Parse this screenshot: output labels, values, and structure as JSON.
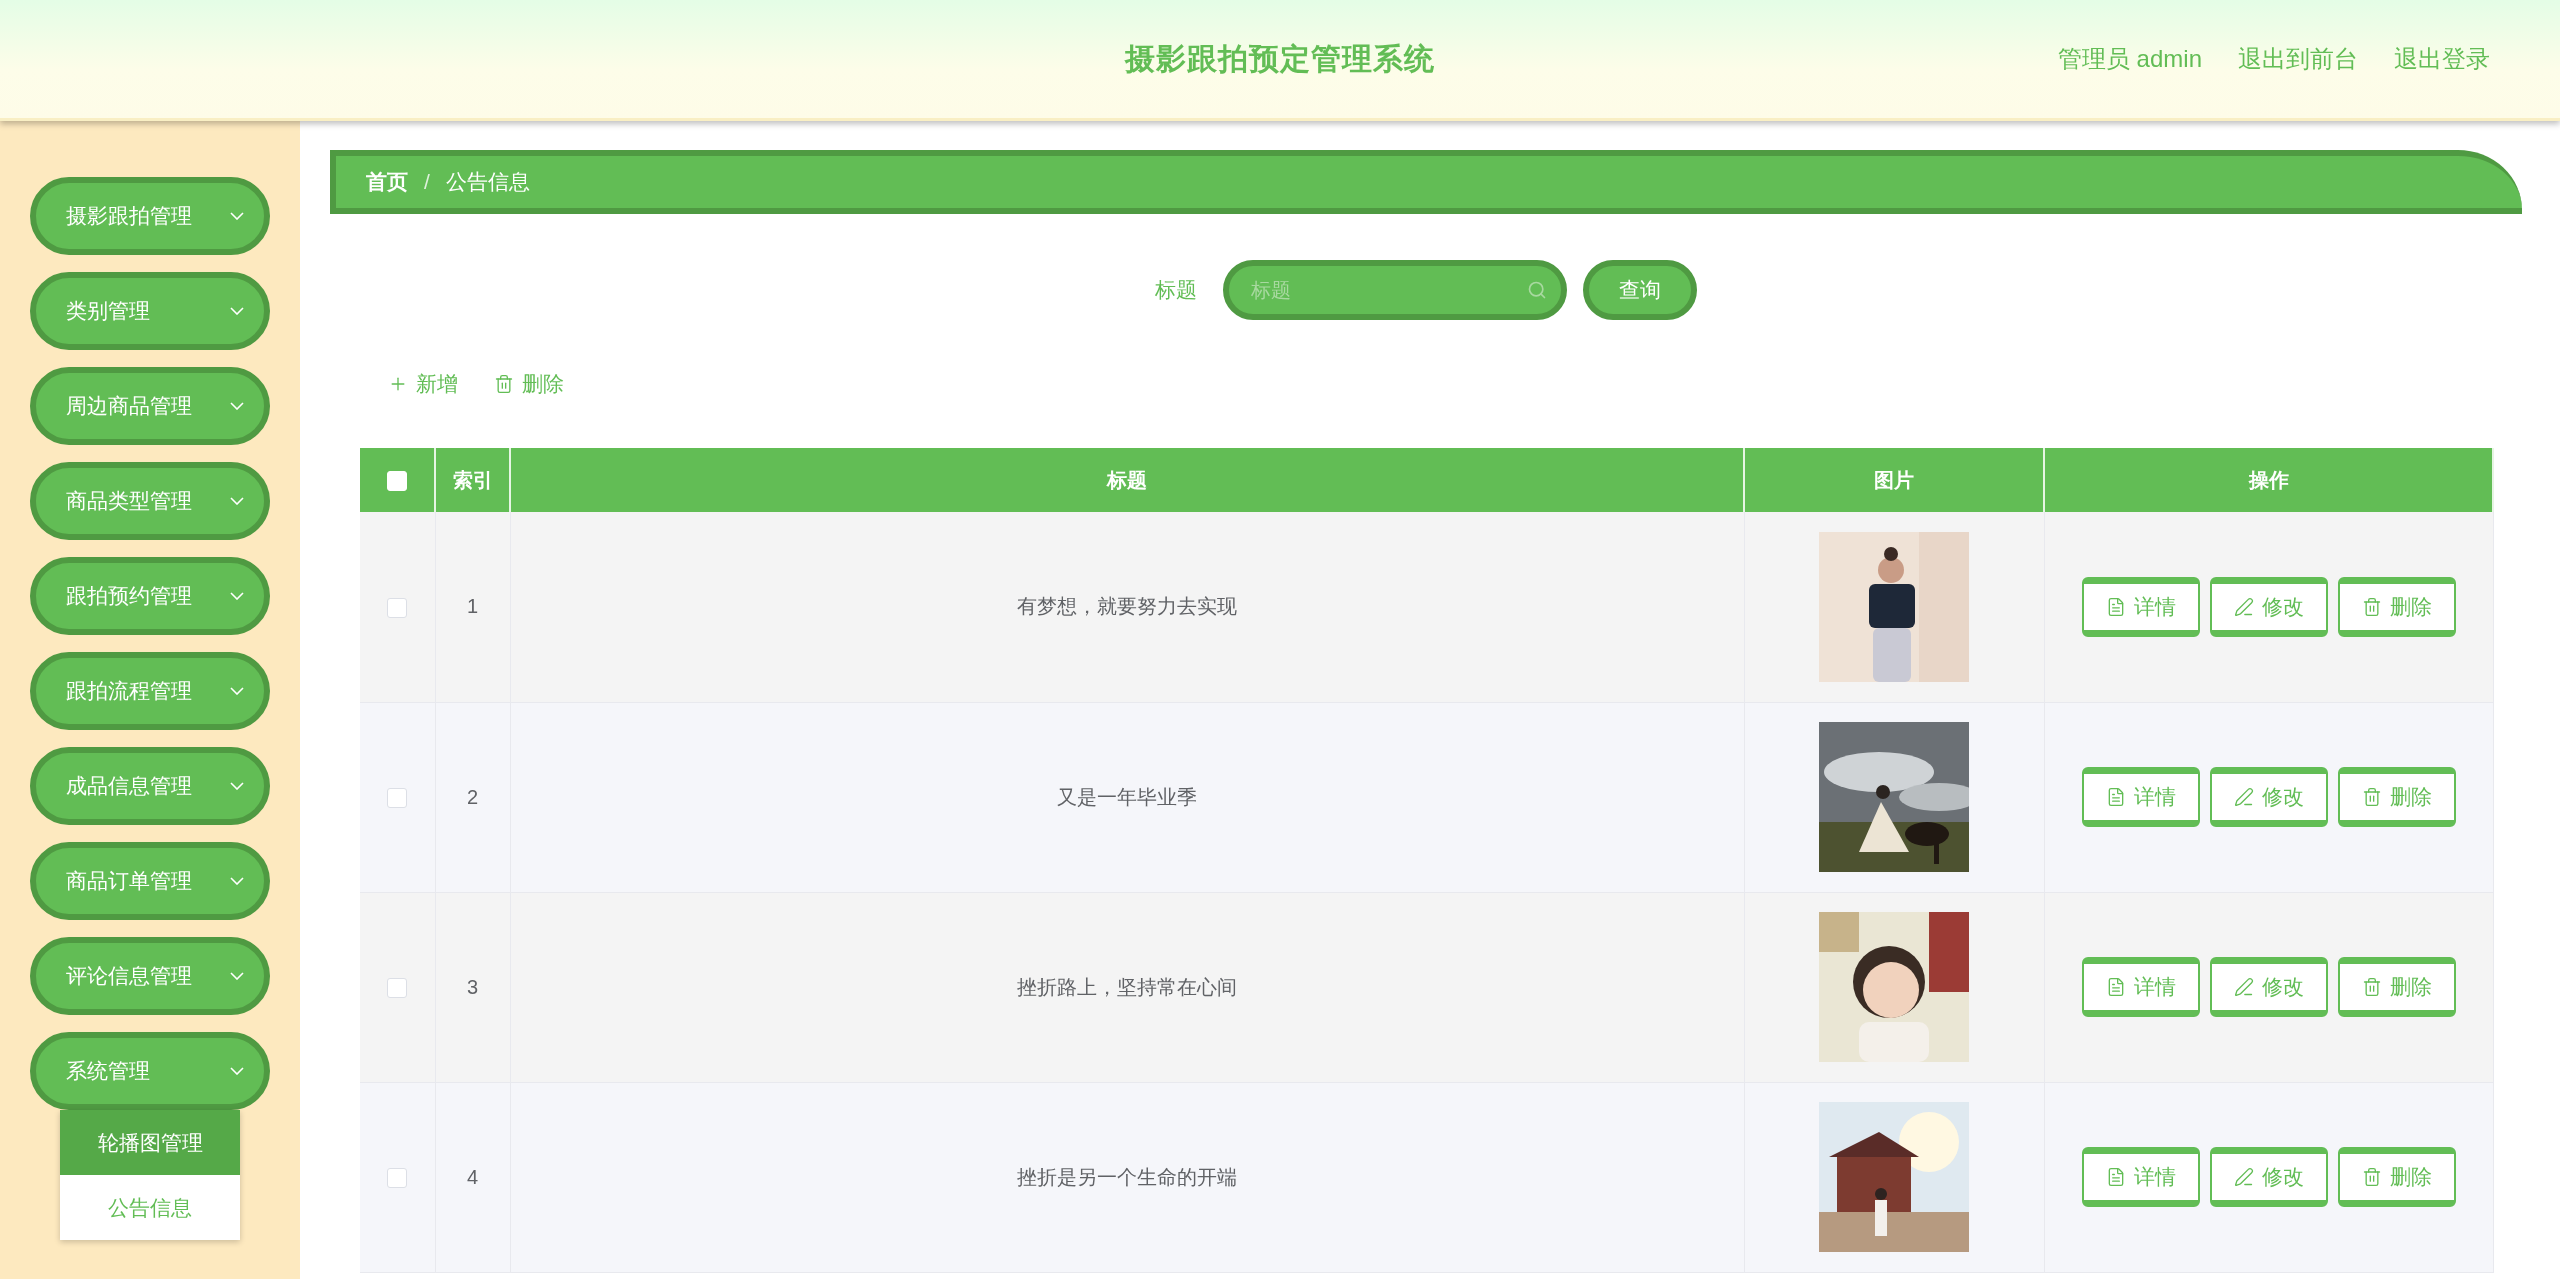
{
  "header": {
    "title": "摄影跟拍预定管理系统",
    "links": [
      "管理员 admin",
      "退出到前台",
      "退出登录"
    ]
  },
  "sidebar": {
    "items": [
      {
        "label": "摄影跟拍管理"
      },
      {
        "label": "类别管理"
      },
      {
        "label": "周边商品管理"
      },
      {
        "label": "商品类型管理"
      },
      {
        "label": "跟拍预约管理"
      },
      {
        "label": "跟拍流程管理"
      },
      {
        "label": "成品信息管理"
      },
      {
        "label": "商品订单管理"
      },
      {
        "label": "评论信息管理"
      },
      {
        "label": "系统管理",
        "expanded": true,
        "children": [
          {
            "label": "轮播图管理",
            "selected": true
          },
          {
            "label": "公告信息",
            "selected": false
          }
        ]
      }
    ]
  },
  "breadcrumb": {
    "items": [
      "首页",
      "公告信息"
    ],
    "separator": "/"
  },
  "search": {
    "label": "标题",
    "placeholder": "标题",
    "button": "查询"
  },
  "toolbar": [
    {
      "kind": "add",
      "label": "新增"
    },
    {
      "kind": "delete",
      "label": "删除"
    }
  ],
  "table": {
    "header_checked": false,
    "columns": [
      "索引",
      "标题",
      "图片",
      "操作"
    ],
    "rows": [
      {
        "checked": false,
        "index": "1",
        "title": "有梦想，就要努力去实现",
        "actions": [
          {
            "kind": "detail",
            "label": "详情"
          },
          {
            "kind": "edit",
            "label": "修改"
          },
          {
            "kind": "delete",
            "label": "删除"
          }
        ]
      },
      {
        "checked": false,
        "index": "2",
        "title": "又是一年毕业季",
        "actions": [
          {
            "kind": "detail",
            "label": "详情"
          },
          {
            "kind": "edit",
            "label": "修改"
          },
          {
            "kind": "delete",
            "label": "删除"
          }
        ]
      },
      {
        "checked": false,
        "index": "3",
        "title": "挫折路上，坚持常在心间",
        "actions": [
          {
            "kind": "detail",
            "label": "详情"
          },
          {
            "kind": "edit",
            "label": "修改"
          },
          {
            "kind": "delete",
            "label": "删除"
          }
        ]
      },
      {
        "checked": false,
        "index": "4",
        "title": "挫折是另一个生命的开端",
        "actions": [
          {
            "kind": "detail",
            "label": "详情"
          },
          {
            "kind": "edit",
            "label": "修改"
          },
          {
            "kind": "delete",
            "label": "删除"
          }
        ]
      }
    ]
  }
}
